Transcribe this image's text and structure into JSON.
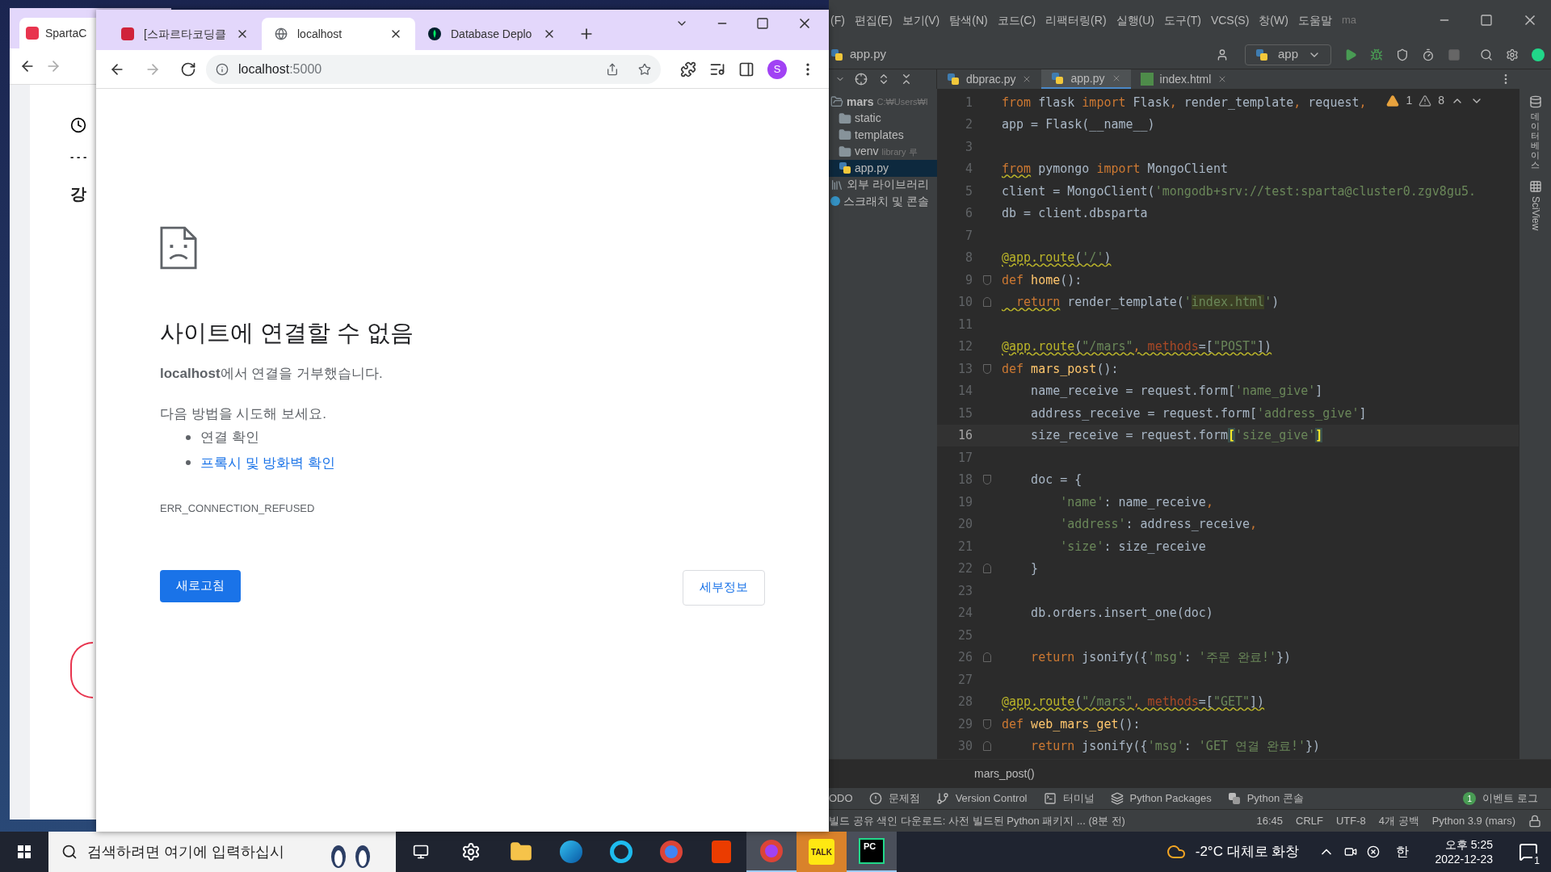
{
  "background_window": {
    "tab": "SpartaC",
    "dashes": "- - -",
    "heading": "강"
  },
  "browser": {
    "tabs": [
      {
        "label": "[스파르타코딩클",
        "kind": "book",
        "selected": false
      },
      {
        "label": "localhost",
        "kind": "globe",
        "selected": true
      },
      {
        "label": "Database Deplo",
        "kind": "leaf",
        "selected": false
      }
    ],
    "address": {
      "host": "localhost",
      "port": ":5000"
    },
    "profile": "S",
    "page": {
      "title": "사이트에 연결할 수 없음",
      "message": "**localhost**에서 연결을 거부했습니다.",
      "try_label": "다음 방법을 시도해 보세요.",
      "suggestions": [
        {
          "text": "연결 확인",
          "kind": "plain"
        },
        {
          "text": "프록시 및 방화벽 확인",
          "kind": "link"
        }
      ],
      "error_code": "ERR_CONNECTION_REFUSED",
      "reload_button": "새로고침",
      "details_button": "세부정보"
    }
  },
  "ide": {
    "menu": [
      "(F)",
      "편집(E)",
      "보기(V)",
      "탐색(N)",
      "코드(C)",
      "리팩터링(R)",
      "실행(U)",
      "도구(T)",
      "VCS(S)",
      "창(W)",
      "도움말"
    ],
    "window_title": "ma",
    "nav_file": "app.py",
    "run_config": "app",
    "editor_tabs": [
      {
        "label": "dbprac.py",
        "kind": "py",
        "selected": false
      },
      {
        "label": "app.py",
        "kind": "py",
        "selected": true
      },
      {
        "label": "index.html",
        "kind": "html",
        "selected": false
      }
    ],
    "project_tree": [
      {
        "label": "mars",
        "hint": "C:₩Users₩l",
        "kind": "root",
        "selected": false,
        "children": [
          {
            "label": "static",
            "kind": "folder",
            "selected": false
          },
          {
            "label": "templates",
            "kind": "folder",
            "selected": false
          },
          {
            "label": "venv",
            "hint": "library 루",
            "kind": "folder",
            "selected": false
          },
          {
            "label": "app.py",
            "kind": "py",
            "selected": true
          }
        ]
      },
      {
        "label": "외부 라이브러리",
        "kind": "lib",
        "selected": false
      },
      {
        "label": "스크래치 및 콘솔",
        "kind": "scratch",
        "selected": false
      }
    ],
    "inspections": {
      "errors": "1",
      "warnings": "8"
    },
    "code": [
      {
        "number": "1",
        "current": false,
        "tokens": [
          {
            "kind": "kw",
            "text": "from"
          },
          {
            "kind": "text",
            "text": " flask "
          },
          {
            "kind": "kw",
            "text": "import"
          },
          {
            "kind": "text",
            "text": " Flask"
          },
          {
            "kind": "kw",
            "text": ","
          },
          {
            "kind": "text",
            "text": " render_template"
          },
          {
            "kind": "kw",
            "text": ","
          },
          {
            "kind": "text",
            "text": " request"
          },
          {
            "kind": "kw",
            "text": ","
          }
        ]
      },
      {
        "number": "2",
        "current": false,
        "tokens": [
          {
            "kind": "text",
            "text": "app = Flask(__name__)"
          }
        ]
      },
      {
        "number": "3",
        "current": false
      },
      {
        "number": "4",
        "current": false,
        "tokens": [
          {
            "kind": "kw",
            "text": "from",
            "underlined": true
          },
          {
            "kind": "text",
            "text": " pymongo "
          },
          {
            "kind": "kw",
            "text": "import"
          },
          {
            "kind": "text",
            "text": " MongoClient"
          }
        ]
      },
      {
        "number": "5",
        "current": false,
        "tokens": [
          {
            "kind": "text",
            "text": "client = MongoClient("
          },
          {
            "kind": "str",
            "text": "'mongodb+srv://test:sparta@cluster0.zgv8gu5."
          }
        ]
      },
      {
        "number": "6",
        "current": false,
        "tokens": [
          {
            "kind": "text",
            "text": "db = client.dbsparta"
          }
        ]
      },
      {
        "number": "7",
        "current": false
      },
      {
        "number": "8",
        "current": false,
        "tokens": [
          {
            "kind": "deco",
            "text": "@app.route",
            "underlined": true
          },
          {
            "kind": "text",
            "text": "(",
            "underlined": true
          },
          {
            "kind": "str",
            "text": "'/'",
            "underlined": true
          },
          {
            "kind": "text",
            "text": ")",
            "underlined": true
          }
        ]
      },
      {
        "number": "9",
        "current": false,
        "fold_open": true,
        "tokens": [
          {
            "kind": "kw",
            "text": "def"
          },
          {
            "kind": "fn",
            "text": " home"
          },
          {
            "kind": "text",
            "text": "():"
          }
        ]
      },
      {
        "number": "10",
        "current": false,
        "fold_close": true,
        "tokens": [
          {
            "kind": "kw",
            "text": "  return",
            "underlined": true
          },
          {
            "kind": "text",
            "text": " render_template("
          },
          {
            "kind": "str",
            "text": "'"
          },
          {
            "kind": "str",
            "text": "index.html",
            "usage_highlight": true
          },
          {
            "kind": "str",
            "text": "'"
          },
          {
            "kind": "text",
            "text": ")"
          }
        ]
      },
      {
        "number": "11",
        "current": false
      },
      {
        "number": "12",
        "current": false,
        "tokens": [
          {
            "kind": "deco",
            "text": "@app.route",
            "underlined": true
          },
          {
            "kind": "text",
            "text": "(",
            "underlined": true
          },
          {
            "kind": "str",
            "text": "\"/mars\"",
            "underlined": true
          },
          {
            "kind": "kw",
            "text": ",",
            "underlined": true
          },
          {
            "kind": "param",
            "text": " methods",
            "underlined": true
          },
          {
            "kind": "text",
            "text": "=[",
            "underlined": true
          },
          {
            "kind": "str",
            "text": "\"POST\"",
            "underlined": true
          },
          {
            "kind": "text",
            "text": "])",
            "underlined": true
          }
        ]
      },
      {
        "number": "13",
        "current": false,
        "fold_open": true,
        "tokens": [
          {
            "kind": "kw",
            "text": "def"
          },
          {
            "kind": "fn",
            "text": " mars_post"
          },
          {
            "kind": "text",
            "text": "():"
          }
        ]
      },
      {
        "number": "14",
        "current": false,
        "tokens": [
          {
            "kind": "text",
            "text": "    name_receive = request.form["
          },
          {
            "kind": "str",
            "text": "'name_give'"
          },
          {
            "kind": "text",
            "text": "]"
          }
        ]
      },
      {
        "number": "15",
        "current": false,
        "tokens": [
          {
            "kind": "text",
            "text": "    address_receive = request.form["
          },
          {
            "kind": "str",
            "text": "'address_give'"
          },
          {
            "kind": "text",
            "text": "]"
          }
        ]
      },
      {
        "number": "16",
        "current": true,
        "tokens": [
          {
            "kind": "text",
            "text": "    size_receive = request.form"
          },
          {
            "kind": "text",
            "text": "[",
            "brace_highlight": true
          },
          {
            "kind": "str",
            "text": "'size_give'"
          },
          {
            "kind": "text",
            "text": "]",
            "brace_highlight": true
          }
        ]
      },
      {
        "number": "17",
        "current": false
      },
      {
        "number": "18",
        "current": false,
        "fold_open": true,
        "tokens": [
          {
            "kind": "text",
            "text": "    doc = {"
          }
        ]
      },
      {
        "number": "19",
        "current": false,
        "tokens": [
          {
            "kind": "str",
            "text": "        'name'"
          },
          {
            "kind": "text",
            "text": ": name_receive"
          },
          {
            "kind": "kw",
            "text": ","
          }
        ]
      },
      {
        "number": "20",
        "current": false,
        "tokens": [
          {
            "kind": "str",
            "text": "        'address'"
          },
          {
            "kind": "text",
            "text": ": address_receive"
          },
          {
            "kind": "kw",
            "text": ","
          }
        ]
      },
      {
        "number": "21",
        "current": false,
        "tokens": [
          {
            "kind": "str",
            "text": "        'size'"
          },
          {
            "kind": "text",
            "text": ": size_receive"
          }
        ]
      },
      {
        "number": "22",
        "current": false,
        "fold_close": true,
        "tokens": [
          {
            "kind": "text",
            "text": "    }"
          }
        ]
      },
      {
        "number": "23",
        "current": false
      },
      {
        "number": "24",
        "current": false,
        "tokens": [
          {
            "kind": "text",
            "text": "    db.orders.insert_one(doc)"
          }
        ]
      },
      {
        "number": "25",
        "current": false
      },
      {
        "number": "26",
        "current": false,
        "fold_close": true,
        "tokens": [
          {
            "kind": "kw",
            "text": "    return"
          },
          {
            "kind": "text",
            "text": " jsonify({"
          },
          {
            "kind": "str",
            "text": "'msg'"
          },
          {
            "kind": "text",
            "text": ": "
          },
          {
            "kind": "str",
            "text": "'주문 완료!'"
          },
          {
            "kind": "text",
            "text": "})"
          }
        ]
      },
      {
        "number": "27",
        "current": false
      },
      {
        "number": "28",
        "current": false,
        "tokens": [
          {
            "kind": "deco",
            "text": "@app.route",
            "underlined": true
          },
          {
            "kind": "text",
            "text": "(",
            "underlined": true
          },
          {
            "kind": "str",
            "text": "\"/mars\"",
            "underlined": true
          },
          {
            "kind": "kw",
            "text": ",",
            "underlined": true
          },
          {
            "kind": "param",
            "text": " methods",
            "underlined": true
          },
          {
            "kind": "text",
            "text": "=[",
            "underlined": true
          },
          {
            "kind": "str",
            "text": "\"GET\"",
            "underlined": true
          },
          {
            "kind": "text",
            "text": "])",
            "underlined": true
          }
        ]
      },
      {
        "number": "29",
        "current": false,
        "fold_open": true,
        "tokens": [
          {
            "kind": "kw",
            "text": "def"
          },
          {
            "kind": "fn",
            "text": " web_mars_get"
          },
          {
            "kind": "text",
            "text": "():"
          }
        ]
      },
      {
        "number": "30",
        "current": false,
        "fold_close": true,
        "tokens": [
          {
            "kind": "kw",
            "text": "    return"
          },
          {
            "kind": "text",
            "text": " jsonify({"
          },
          {
            "kind": "str",
            "text": "'msg'"
          },
          {
            "kind": "text",
            "text": ": "
          },
          {
            "kind": "str",
            "text": "'GET 연결 완료!'"
          },
          {
            "kind": "text",
            "text": "})"
          }
        ]
      }
    ],
    "right_strip": [
      {
        "label": "데이터베이스",
        "kind": "database"
      },
      {
        "label": "SciView",
        "kind": "grid"
      }
    ],
    "breadcrumb": "mars_post()",
    "tool_windows": [
      {
        "label": "ODO",
        "kind": "none"
      },
      {
        "label": "문제점",
        "kind": "problems"
      },
      {
        "label": "Version Control",
        "kind": "vcs"
      },
      {
        "label": "터미널",
        "kind": "terminal"
      },
      {
        "label": "Python Packages",
        "kind": "packages"
      },
      {
        "label": "Python 콘솔",
        "kind": "python"
      }
    ],
    "event_log": {
      "count": "1",
      "label": "이벤트 로그"
    },
    "status": {
      "message": "빌드 공유 색인 다운로드: 사전 빌드된 Python 패키지 ... (8분 전)",
      "items": [
        "16:45",
        "CRLF",
        "UTF-8",
        "4개 공백",
        "Python 3.9 (mars)"
      ]
    }
  },
  "taskbar": {
    "search": {
      "placeholder": "검색하려면 여기에 입력하십시"
    },
    "apps": [
      {
        "kind": "task-view",
        "active": false,
        "flashing": false
      },
      {
        "kind": "settings",
        "active": false,
        "flashing": false
      },
      {
        "kind": "explorer",
        "active": false,
        "flashing": false
      },
      {
        "kind": "edge",
        "active": false,
        "flashing": false
      },
      {
        "kind": "ie",
        "active": false,
        "flashing": false
      },
      {
        "kind": "chrome",
        "active": false,
        "flashing": false
      },
      {
        "kind": "office",
        "active": false,
        "flashing": false
      },
      {
        "kind": "chrome-profile",
        "active": true,
        "flashing": false
      },
      {
        "kind": "kakao",
        "label": "TALK",
        "active": false,
        "flashing": true
      },
      {
        "kind": "pycharm",
        "label": "PC",
        "active": true,
        "flashing": false
      }
    ],
    "weather": "-2°C 대체로 화창",
    "ime": "한",
    "time": "오후 5:25",
    "date": "2022-12-23",
    "notifications": "1"
  }
}
